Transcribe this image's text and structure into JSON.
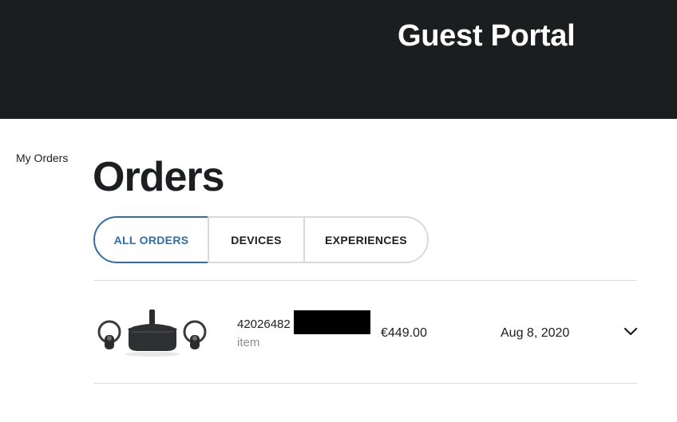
{
  "header": {
    "title": "Guest Portal",
    "background": "#1c1d1f"
  },
  "sidebar": {
    "items": [
      {
        "label": "My Orders"
      }
    ]
  },
  "main": {
    "title": "Orders",
    "tabs": [
      {
        "label": "ALL ORDERS",
        "active": true
      },
      {
        "label": "DEVICES",
        "active": false
      },
      {
        "label": "EXPERIENCES",
        "active": false
      }
    ],
    "orders": [
      {
        "id_visible": "42026482",
        "type": "item",
        "price": "€449.00",
        "date": "Aug 8, 2020",
        "thumbnail_icon": "vr-headset-icon"
      }
    ]
  },
  "colors": {
    "accent": "#2e6db4",
    "border": "#d7d9dd",
    "muted_text": "#8a8d91"
  }
}
